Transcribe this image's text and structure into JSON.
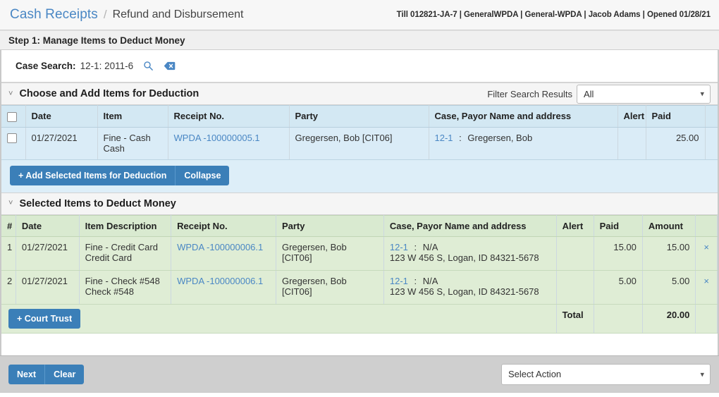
{
  "header": {
    "breadcrumb_main": "Cash Receipts",
    "breadcrumb_separator": "/",
    "breadcrumb_sub": "Refund and Disbursement",
    "till_info": "Till 012821-JA-7 | GeneralWPDA | General-WPDA | Jacob Adams | Opened 01/28/21"
  },
  "step": {
    "title": "Step 1: Manage Items to Deduct Money"
  },
  "case_search": {
    "label": "Case Search:",
    "value": "12-1: 2011-6",
    "search_icon": "search-icon",
    "clear_icon": "clear-tag-icon"
  },
  "choose_section": {
    "chevron": "˅",
    "title": "Choose and Add Items for Deduction",
    "filter_label": "Filter Search Results",
    "filter_selected": "All",
    "filter_options": [
      "All"
    ],
    "columns": [
      "",
      "Date",
      "Item",
      "Receipt No.",
      "Party",
      "Case, Payor Name and address",
      "Alert",
      "Paid",
      ""
    ],
    "rows": [
      {
        "checkbox": false,
        "date": "01/27/2021",
        "item_line1": "Fine - Cash",
        "item_line2": "Cash",
        "receipt_no": "WPDA -100000005.1",
        "party": "Gregersen, Bob [CIT06]",
        "case_no": "12-1",
        "case_sep": ":",
        "payor": "Gregersen, Bob",
        "address": "",
        "alert": "",
        "paid": "25.00"
      }
    ],
    "add_button": "+ Add Selected Items for Deduction",
    "collapse_button": "Collapse"
  },
  "selected_section": {
    "chevron": "˅",
    "title": "Selected Items to Deduct Money",
    "columns": [
      "#",
      "Date",
      "Item Description",
      "Receipt No.",
      "Party",
      "Case, Payor Name and address",
      "Alert",
      "Paid",
      "Amount",
      ""
    ],
    "rows": [
      {
        "num": "1",
        "date": "01/27/2021",
        "item_line1": "Fine - Credit Card",
        "item_line2": "Credit Card",
        "receipt_no": "WPDA -100000006.1",
        "party": "Gregersen, Bob [CIT06]",
        "case_no": "12-1",
        "case_sep": ":",
        "payor": "N/A",
        "address": "123 W 456 S, Logan, ID 84321-5678",
        "alert": "",
        "paid": "15.00",
        "amount": "15.00",
        "remove": "×"
      },
      {
        "num": "2",
        "date": "01/27/2021",
        "item_line1": "Fine - Check #548",
        "item_line2": "Check #548",
        "receipt_no": "WPDA -100000006.1",
        "party": "Gregersen, Bob [CIT06]",
        "case_no": "12-1",
        "case_sep": ":",
        "payor": "N/A",
        "address": "123 W 456 S, Logan, ID 84321-5678",
        "alert": "",
        "paid": "5.00",
        "amount": "5.00",
        "remove": "×"
      }
    ],
    "court_trust_button": "+ Court Trust",
    "total_label": "Total",
    "total_amount": "20.00"
  },
  "footer": {
    "next_button": "Next",
    "clear_button": "Clear",
    "action_selected": "Select Action",
    "action_options": [
      "Select Action"
    ]
  },
  "colors": {
    "accent_blue": "#3b7fb8",
    "link_blue": "#4a87c4",
    "blue_row": "#daecf7",
    "blue_header": "#d3e8f3",
    "green_row": "#dfedd5",
    "green_header": "#d9ead0",
    "footer_gray": "#cfcfcf"
  }
}
